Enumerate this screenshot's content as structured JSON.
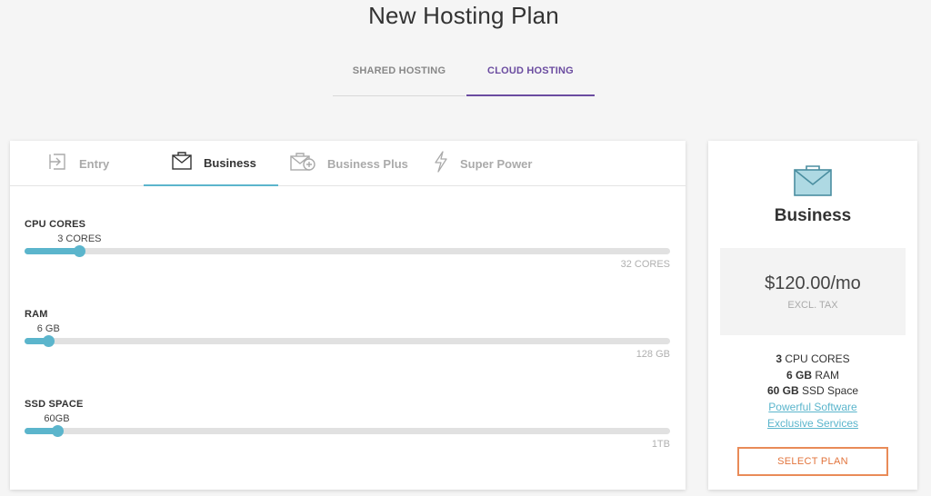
{
  "page_title": "New Hosting Plan",
  "hosting_types": [
    {
      "label": "SHARED HOSTING",
      "active": false
    },
    {
      "label": "CLOUD HOSTING",
      "active": true
    }
  ],
  "plan_tabs": [
    {
      "label": "Entry",
      "icon": "entry-icon",
      "active": false
    },
    {
      "label": "Business",
      "icon": "envelope-icon",
      "active": true
    },
    {
      "label": "Business Plus",
      "icon": "envelope-plus-icon",
      "active": false
    },
    {
      "label": "Super Power",
      "icon": "lightning-icon",
      "active": false
    }
  ],
  "sliders": [
    {
      "label": "CPU CORES",
      "value_label": "3 CORES",
      "max_label": "32 CORES",
      "fraction": 0.085
    },
    {
      "label": "RAM",
      "value_label": "6 GB",
      "max_label": "128 GB",
      "fraction": 0.037
    },
    {
      "label": "SSD SPACE",
      "value_label": "60GB",
      "max_label": "1TB",
      "fraction": 0.05
    }
  ],
  "summary": {
    "title": "Business",
    "icon": "envelope-icon",
    "price": "$120.00/mo",
    "tax_note": "EXCL. TAX",
    "features": [
      {
        "bold": "3",
        "text": " CPU CORES"
      },
      {
        "bold": "6 GB",
        "text": " RAM"
      },
      {
        "bold": "60 GB",
        "text": " SSD Space"
      }
    ],
    "links": [
      "Powerful Software",
      "Exclusive Services"
    ],
    "select_label": "SELECT PLAN"
  },
  "colors": {
    "accent": "#5bb5cc",
    "cloud_tab": "#6b4ca0",
    "select_button": "#e98b58"
  }
}
